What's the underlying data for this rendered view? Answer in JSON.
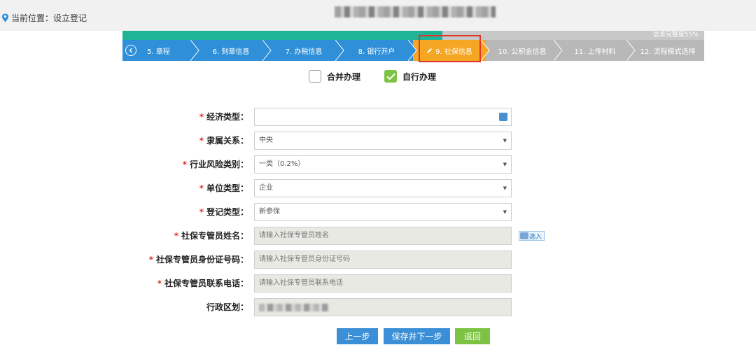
{
  "location": {
    "label": "当前位置：设立登记"
  },
  "progress": {
    "percent": 55,
    "text": "信息完整度55%"
  },
  "steps": [
    {
      "label": "5. 章程",
      "state": "done"
    },
    {
      "label": "6. 刻章信息",
      "state": "done"
    },
    {
      "label": "7. 办税信息",
      "state": "done"
    },
    {
      "label": "8. 银行开户",
      "state": "done"
    },
    {
      "label": "9. 社保信息",
      "state": "active"
    },
    {
      "label": "10. 公积金信息",
      "state": "todo"
    },
    {
      "label": "11. 上传材料",
      "state": "todo"
    },
    {
      "label": "12. 流程模式选择",
      "state": "todo"
    }
  ],
  "mode": {
    "combined": {
      "label": "合并办理",
      "checked": false
    },
    "self": {
      "label": "自行办理",
      "checked": true
    }
  },
  "form": {
    "economic_type": {
      "label": "经济类型：",
      "value": ""
    },
    "affiliation": {
      "label": "隶属关系：",
      "value": "中央"
    },
    "risk_category": {
      "label": "行业风险类别：",
      "value": "一类（0.2%）"
    },
    "unit_type": {
      "label": "单位类型：",
      "value": "企业"
    },
    "register_type": {
      "label": "登记类型：",
      "value": "新参保"
    },
    "manager_name": {
      "label": "社保专管员姓名：",
      "placeholder": "请输入社保专管员姓名"
    },
    "manager_id": {
      "label": "社保专管员身份证号码：",
      "placeholder": "请输入社保专管员身份证号码"
    },
    "manager_phone": {
      "label": "社保专管员联系电话：",
      "placeholder": "请输入社保专管员联系电话"
    },
    "district": {
      "label": "行政区划："
    },
    "import_label": "选入"
  },
  "buttons": {
    "prev": "上一步",
    "save_next": "保存并下一步",
    "back": "返回"
  },
  "colors": {
    "done": "#2f8fd8",
    "active": "#f5a623",
    "todo": "#b8b8b8",
    "progress": "#1fb496",
    "required": "#e0352b",
    "back_button": "#7cc243"
  }
}
